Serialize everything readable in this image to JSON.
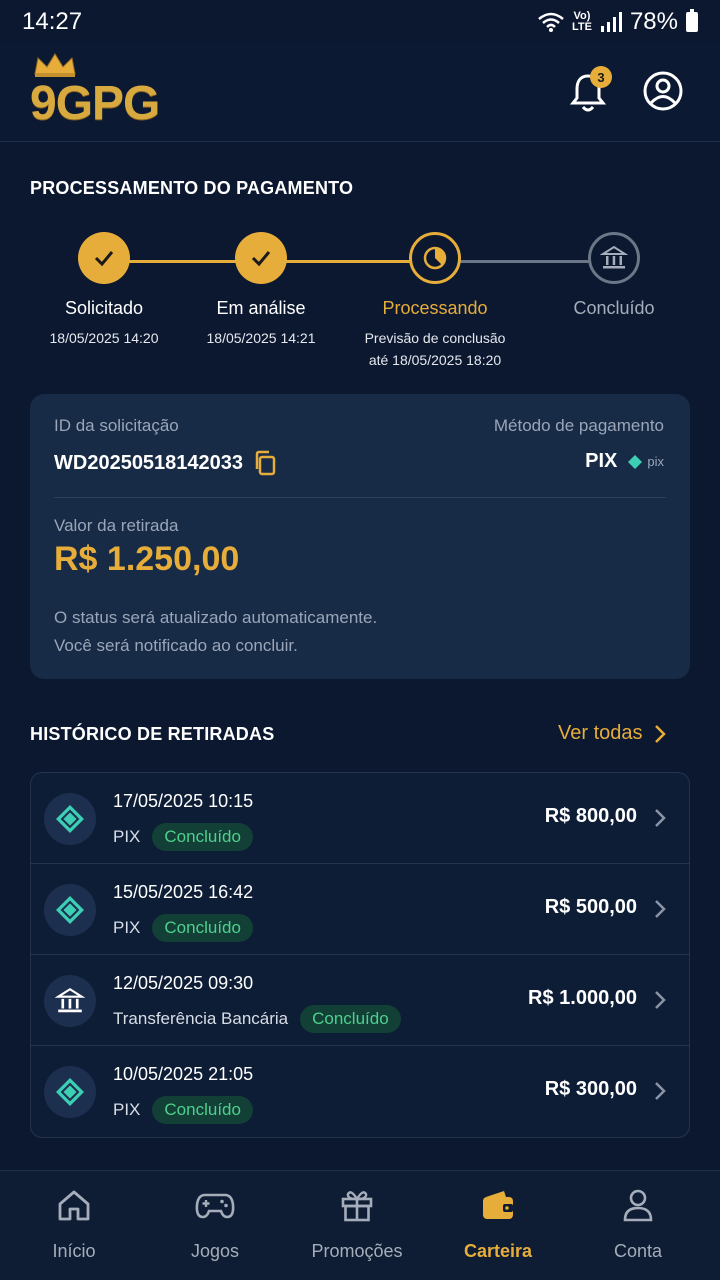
{
  "status_bar": {
    "time": "14:27",
    "battery": "78%",
    "network": "LTE"
  },
  "header": {
    "logo": "9GPG",
    "notification_count": "3"
  },
  "payment": {
    "title": "PROCESSAMENTO DO PAGAMENTO",
    "steps": [
      {
        "label": "Solicitado",
        "date": "18/05/2025 14:20",
        "state": "done"
      },
      {
        "label": "Em análise",
        "date": "18/05/2025 14:21",
        "state": "done"
      },
      {
        "label": "Processando",
        "sub1": "Previsão de conclusão",
        "sub2": "até 18/05/2025 18:20",
        "state": "active"
      },
      {
        "label": "Concluído",
        "state": "todo"
      }
    ],
    "request_id_label": "ID da solicitação",
    "request_id": "WD20250518142033",
    "method_label": "Método de pagamento",
    "method": "PIX",
    "method_logo": "pix",
    "amount_label": "Valor da retirada",
    "amount": "R$ 1.250,00",
    "note_line1": "O status será atualizado automaticamente.",
    "note_line2": "Você será notificado ao concluir."
  },
  "history": {
    "title": "HISTÓRICO DE RETIRADAS",
    "see_all": "Ver todas",
    "items": [
      {
        "date": "17/05/2025 10:15",
        "method": "PIX",
        "status": "Concluído",
        "amount": "R$ 800,00",
        "icon": "pix-icon"
      },
      {
        "date": "15/05/2025 16:42",
        "method": "PIX",
        "status": "Concluído",
        "amount": "R$ 500,00",
        "icon": "pix-icon"
      },
      {
        "date": "12/05/2025 09:30",
        "method": "Transferência Bancária",
        "status": "Concluído",
        "amount": "R$ 1.000,00",
        "icon": "bank-icon"
      },
      {
        "date": "10/05/2025 21:05",
        "method": "PIX",
        "status": "Concluído",
        "amount": "R$ 300,00",
        "icon": "pix-icon"
      }
    ]
  },
  "nav": {
    "items": [
      {
        "label": "Início",
        "icon": "home-icon"
      },
      {
        "label": "Jogos",
        "icon": "gamepad-icon"
      },
      {
        "label": "Promoções",
        "icon": "gift-icon"
      },
      {
        "label": "Carteira",
        "icon": "wallet-icon",
        "active": true
      },
      {
        "label": "Conta",
        "icon": "user-icon"
      }
    ]
  },
  "colors": {
    "accent": "#e6ad3a",
    "success": "#4ed08e",
    "pix": "#3ccfb4",
    "background": "#0b1830"
  }
}
